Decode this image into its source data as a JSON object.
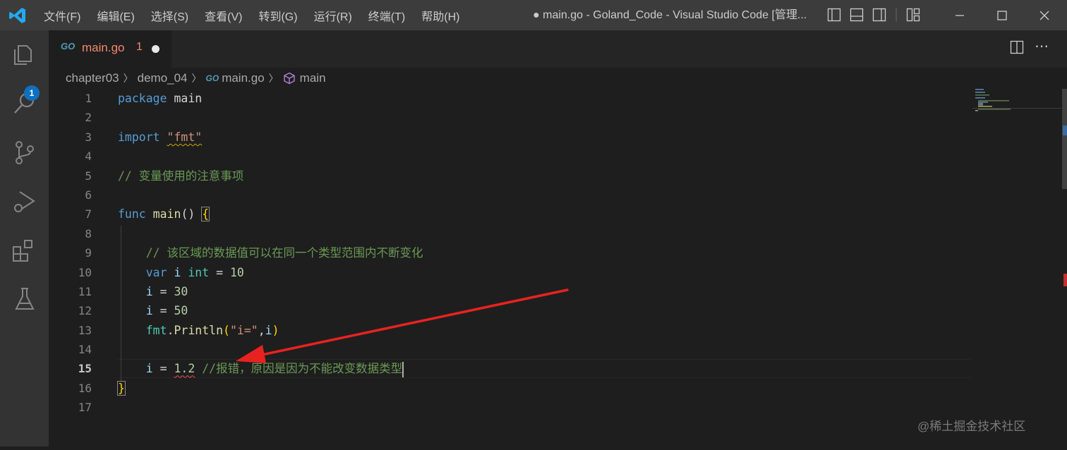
{
  "menu": [
    "文件(F)",
    "编辑(E)",
    "选择(S)",
    "查看(V)",
    "转到(G)",
    "运行(R)",
    "终端(T)",
    "帮助(H)"
  ],
  "window_title": "● main.go - Goland_Code - Visual Studio Code [管理...",
  "activity": {
    "explorer_badge": "1"
  },
  "tab": {
    "icon": "GO",
    "name": "main.go",
    "problems": "1"
  },
  "breadcrumb": {
    "folder1": "chapter03",
    "folder2": "demo_04",
    "file_icon": "GO",
    "file": "main.go",
    "symbol": "main"
  },
  "line_numbers": [
    "1",
    "2",
    "3",
    "4",
    "5",
    "6",
    "7",
    "8",
    "9",
    "10",
    "11",
    "12",
    "13",
    "14",
    "15",
    "16",
    "17"
  ],
  "active_line": "15",
  "code": {
    "l1_kw": "package",
    "l1_name": "main",
    "l3_kw": "import",
    "l3_str": "\"fmt\"",
    "l5_comment": "// 变量使用的注意事项",
    "l7_kw": "func",
    "l7_fn": "main",
    "l7_rest": "() ",
    "l7_brace": "{",
    "l9_comment": "// 该区域的数据值可以在同一个类型范围内不断变化",
    "l10_kw": "var",
    "l10_var": "i",
    "l10_type": "int",
    "l10_eq": " = ",
    "l10_num": "10",
    "l11_var": "i",
    "l11_eq": " = ",
    "l11_num": "30",
    "l12_var": "i",
    "l12_eq": " = ",
    "l12_num": "50",
    "l13_pkg": "fmt",
    "l13_dot": ".",
    "l13_fn": "Println",
    "l13_open": "(",
    "l13_str": "\"i=\"",
    "l13_comma": ",",
    "l13_var": "i",
    "l13_close": ")",
    "l15_var": "i",
    "l15_eq": " = ",
    "l15_num": "1.2",
    "l15_comment": " //报错，原因是因为不能改变数据类型",
    "l16_brace": "}"
  },
  "watermark": "@稀土掘金技术社区",
  "colors": {
    "annotation_arrow": "#e8231f",
    "error_squiggle": "#f14c4c",
    "keyword": "#569cd6"
  }
}
